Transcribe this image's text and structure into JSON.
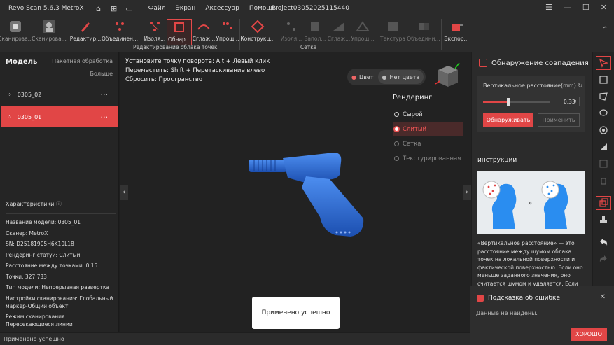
{
  "app": {
    "title": "Revo Scan 5.6.3 MetroX",
    "menu": [
      "Файл",
      "Экран",
      "Аксессуар",
      "Помощь"
    ],
    "project": "Project03052025115440"
  },
  "toolbar": {
    "buttons": [
      {
        "label": "Сканирова..."
      },
      {
        "label": "Сканирова..."
      },
      {
        "label": "Редактир..."
      },
      {
        "label": "Объединен..."
      },
      {
        "label": "Изоля..."
      },
      {
        "label": "Обнар..."
      },
      {
        "label": "Сглаж..."
      },
      {
        "label": "Упрощ..."
      },
      {
        "label": "Конструкц..."
      },
      {
        "label": "Изоля..."
      },
      {
        "label": "Запол..."
      },
      {
        "label": "Сглаж..."
      },
      {
        "label": "Упрощ..."
      },
      {
        "label": "Текстура"
      },
      {
        "label": "Объедини..."
      },
      {
        "label": "Экспор..."
      }
    ],
    "group_pointcloud": "Редактирование облака точек",
    "group_mesh": "Сетка"
  },
  "left": {
    "header": "Модель",
    "batch": "Пакетная обработка",
    "more": "Больше",
    "models": [
      {
        "name": "0305_02",
        "selected": false
      },
      {
        "name": "0305_01",
        "selected": true
      }
    ],
    "props_title": "Характеристики",
    "props": [
      "Название модели:  0305_01",
      "Сканер:  MetroX",
      "SN:  D25181905H6K10L18",
      "Рендеринг статуи:  Слитый",
      "Расстояние между точками:  0.15",
      "Точки:  327,733",
      "Тип модели:  Непрерывная развертка",
      "Настройки сканирования:  Глобальный маркер-Общий объект",
      "Режим сканирования:  Пересекающиеся линии"
    ]
  },
  "viewport": {
    "hint1": "Установите точку поворота: Alt + Левый клик",
    "hint2": "Переместить: Shift + Перетаскивание влево",
    "hint3": "Сбросить: Пространство",
    "color_on": "Цвет",
    "color_off": "Нет цвета",
    "render_title": "Рендеринг",
    "render_options": [
      "Сырой",
      "Слитый",
      "Сетка",
      "Текстурированная"
    ],
    "render_selected": "Слитый",
    "toast": "Применено успешно"
  },
  "right": {
    "title": "Обнаружение совпадения",
    "distance_label": "Вертикальное расстояние(mm)",
    "distance_value": "0.33",
    "slider_level": 0.38,
    "detect_button": "Обнаруживать",
    "apply_button": "Применить",
    "instr_title": "инструкции",
    "instr_text": "«Вертикальное расстояние» — это расстояние между шумом облака точек на локальной поверхности и фактической поверхностью. Если оно меньше заданного значения, оно считается шумом и удаляется. Если оно"
  },
  "error": {
    "title": "Подсказка об ошибке",
    "message": "Данные не найдены.",
    "ok": "ХОРОШО"
  },
  "status": "Применено успешно",
  "colors": {
    "accent": "#e14646",
    "model": "#2f6fd6"
  }
}
